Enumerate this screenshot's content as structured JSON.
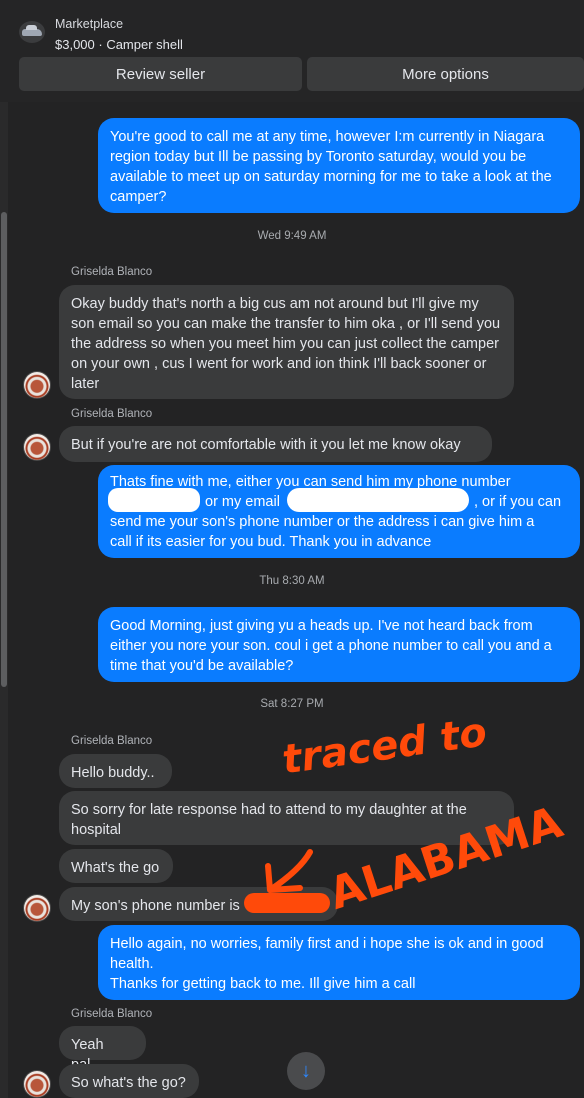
{
  "header": {
    "label": "Marketplace",
    "listing_title": "$3,000 · Camper shell",
    "review_seller_label": "Review seller",
    "more_options_label": "More options"
  },
  "messages": [
    {
      "text": "You're good to call me at any time, however I:m currently in Niagara region today but Ill be passing by Toronto saturday, would you be available to meet up on saturday morning for me to take a look at the camper?"
    },
    {
      "text": "Okay buddy that's north a big cus am not around but I'll give my son email so you can make the transfer to him oka , or I'll send you the address so when you meet him you can just collect the camper on your own , cus I went for work and ion think I'll back sooner or later"
    },
    {
      "text": "But if you're are not comfortable with it you let me know okay"
    },
    {
      "line1": "Thats fine with me, either you can send him my phone number",
      "mid_a": "or my email",
      "mid_b": ", or if you can",
      "line3": "send me your son's phone number or the address i can give him a",
      "line4": "call if its easier for you bud. Thank you in advance"
    },
    {
      "text": "Good Morning, just giving yu a heads up. I've not heard back from either you nore your son. coul i get a phone number to call you and a time that you'd be available?"
    },
    {
      "text": "Hello buddy.."
    },
    {
      "text": "So sorry for late response had to attend to my daughter at the hospital"
    },
    {
      "text": "What's the go"
    },
    {
      "text": "My son's phone number is"
    },
    {
      "line1": "Hello again, no worries, family first and i hope she is ok and in good health.",
      "line2": "Thanks for getting back to me. Ill give him a call"
    },
    {
      "text": "Yeah pal.."
    },
    {
      "text": "So what's the go?"
    }
  ],
  "timestamps": [
    "Wed 9:49 AM",
    "Thu 8:30 AM",
    "Sat 8:27 PM"
  ],
  "sender_name": "Griselda Blanco",
  "annotation": {
    "line1": "traced to",
    "line2": "ALABAMA",
    "color": "#ff4a0a"
  },
  "colors": {
    "outgoing_bubble": "#0a7cff",
    "incoming_bubble": "#3a3b3c",
    "background": "#232324"
  },
  "icons": {
    "scroll_button": "arrow-down-icon",
    "marketplace": "listing-thumbnail-icon"
  }
}
